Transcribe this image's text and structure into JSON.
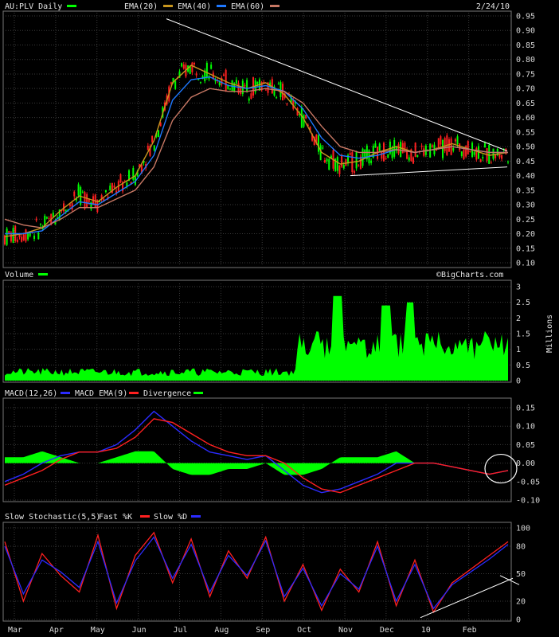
{
  "header": {
    "symbol_label": "AU:PLV Daily",
    "ema20_label": "EMA(20)",
    "ema40_label": "EMA(40)",
    "ema60_label": "EMA(60)",
    "date": "2/24/10"
  },
  "volume_panel": {
    "title": "Volume",
    "watermark": "©BigCharts.com",
    "unit_label": "Millions"
  },
  "macd_panel": {
    "title": "MACD(12,26)",
    "ema_label": "MACD EMA(9)",
    "div_label": "Divergence"
  },
  "stoch_panel": {
    "title": "Slow Stochastic(5,5)",
    "fast_label": "Fast %K",
    "slow_label": "Slow %D"
  },
  "colors": {
    "price": "#00ff00",
    "ema20": "#c8961e",
    "ema40": "#1e78ff",
    "ema60": "#c87864",
    "volume": "#00ff00",
    "macd": "#2b2bff",
    "macd_ema": "#ff2020",
    "divergence": "#00ff00",
    "fastK": "#ff2020",
    "slowD": "#2b2bff",
    "trendline": "#ffffff",
    "grid": "#3a3a3a"
  },
  "chart_data": [
    {
      "type": "candlestick",
      "title": "AU:PLV Daily",
      "x": [
        "Mar",
        "Apr",
        "May",
        "Jun",
        "Jul",
        "Aug",
        "Sep",
        "Oct",
        "Nov",
        "Dec",
        "10",
        "Feb"
      ],
      "ylim": [
        0.1,
        0.95
      ],
      "yticks": [
        0.95,
        0.9,
        0.85,
        0.8,
        0.75,
        0.7,
        0.65,
        0.6,
        0.55,
        0.5,
        0.45,
        0.4,
        0.35,
        0.3,
        0.25,
        0.2,
        0.15,
        0.1
      ],
      "series": [
        {
          "name": "EMA(20)",
          "values": [
            0.19,
            0.2,
            0.22,
            0.28,
            0.33,
            0.31,
            0.36,
            0.4,
            0.52,
            0.72,
            0.78,
            0.75,
            0.72,
            0.7,
            0.72,
            0.68,
            0.6,
            0.48,
            0.44,
            0.45,
            0.48,
            0.5,
            0.48,
            0.49,
            0.51,
            0.49,
            0.47,
            0.48
          ]
        },
        {
          "name": "EMA(40)",
          "values": [
            0.2,
            0.2,
            0.21,
            0.26,
            0.31,
            0.3,
            0.34,
            0.38,
            0.47,
            0.66,
            0.73,
            0.74,
            0.71,
            0.7,
            0.71,
            0.69,
            0.63,
            0.53,
            0.47,
            0.46,
            0.47,
            0.49,
            0.48,
            0.49,
            0.5,
            0.49,
            0.48,
            0.48
          ]
        },
        {
          "name": "EMA(60)",
          "values": [
            0.25,
            0.23,
            0.22,
            0.25,
            0.29,
            0.29,
            0.32,
            0.35,
            0.43,
            0.59,
            0.67,
            0.7,
            0.69,
            0.69,
            0.7,
            0.69,
            0.65,
            0.57,
            0.5,
            0.48,
            0.48,
            0.49,
            0.48,
            0.49,
            0.5,
            0.49,
            0.48,
            0.48
          ]
        }
      ]
    },
    {
      "type": "area",
      "title": "Volume",
      "ylabel": "Millions",
      "ylim": [
        0,
        3
      ],
      "yticks": [
        3,
        2.5,
        2,
        1.5,
        1,
        0.5,
        0
      ]
    },
    {
      "type": "line",
      "title": "MACD(12,26)",
      "ylim": [
        -0.1,
        0.15
      ],
      "yticks": [
        0.15,
        0.1,
        0.05,
        0.0,
        -0.05,
        -0.1
      ],
      "series": [
        {
          "name": "MACD(12,26)",
          "values": [
            -0.05,
            -0.03,
            0.0,
            0.02,
            0.03,
            0.03,
            0.05,
            0.09,
            0.14,
            0.1,
            0.06,
            0.03,
            0.02,
            0.01,
            0.02,
            -0.02,
            -0.06,
            -0.08,
            -0.07,
            -0.05,
            -0.03,
            0.0,
            0.0,
            0.0,
            -0.01,
            -0.02,
            -0.03,
            -0.02
          ]
        },
        {
          "name": "MACD EMA(9)",
          "values": [
            -0.06,
            -0.04,
            -0.02,
            0.01,
            0.03,
            0.03,
            0.04,
            0.07,
            0.12,
            0.11,
            0.08,
            0.05,
            0.03,
            0.02,
            0.02,
            0.0,
            -0.04,
            -0.07,
            -0.08,
            -0.06,
            -0.04,
            -0.02,
            0.0,
            0.0,
            -0.01,
            -0.02,
            -0.03,
            -0.02
          ]
        }
      ]
    },
    {
      "type": "line",
      "title": "Slow Stochastic(5,5)",
      "ylim": [
        0,
        100
      ],
      "yticks": [
        100,
        80,
        50,
        20,
        0
      ],
      "series": [
        {
          "name": "Fast %K",
          "values": [
            85,
            20,
            72,
            48,
            30,
            92,
            12,
            70,
            95,
            40,
            88,
            25,
            75,
            45,
            90,
            20,
            60,
            10,
            55,
            30,
            85,
            15,
            65,
            8,
            40,
            55,
            70,
            85
          ]
        },
        {
          "name": "Slow %D",
          "values": [
            80,
            28,
            65,
            52,
            35,
            85,
            18,
            64,
            90,
            45,
            82,
            30,
            70,
            48,
            86,
            25,
            56,
            15,
            50,
            33,
            80,
            20,
            60,
            12,
            38,
            52,
            66,
            82
          ]
        }
      ]
    }
  ]
}
